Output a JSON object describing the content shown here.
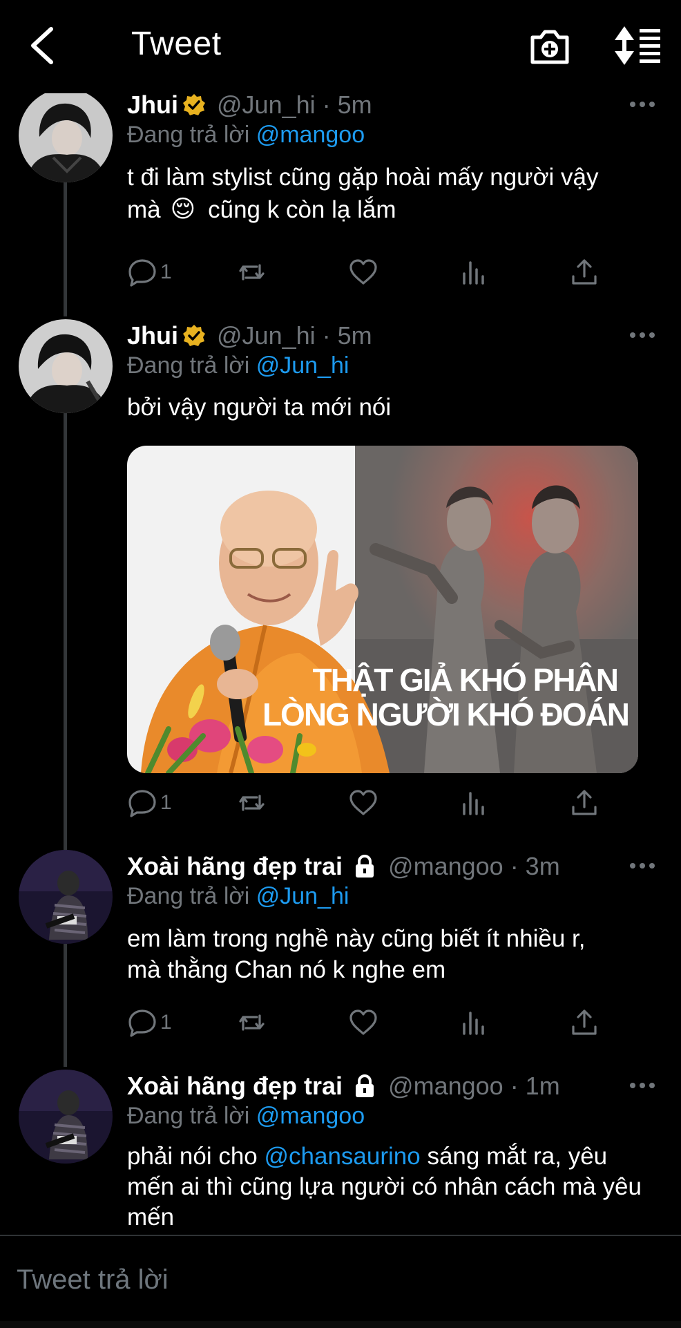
{
  "header": {
    "title": "Tweet",
    "back_icon": "chevron-left-icon",
    "camera_icon": "camera-add-icon",
    "sort_icon": "sort-icon"
  },
  "tweets": [
    {
      "name": "Jhui",
      "verified": true,
      "handle_time": "@Jun_hi · 5m",
      "reply_prefix": "Đang trả lời",
      "reply_to": "@mangoo",
      "text_line1": "t đi làm stylist cũng gặp hoài mấy người vậy",
      "text_line2_a": "mà",
      "text_line2_emoji": "😌",
      "text_line2_b": "cũng k còn lạ lắm",
      "reply_count": "1"
    },
    {
      "name": "Jhui",
      "verified": true,
      "handle_time": "@Jun_hi · 5m",
      "reply_prefix": "Đang trả lời",
      "reply_to": "@Jun_hi",
      "text": "bởi vậy người ta mới nói",
      "media_caption_line1": "THẬT GIẢ KHÓ PHÂN",
      "media_caption_line2": "LÒNG NGƯỜI KHÓ ĐOÁN",
      "reply_count": "1"
    },
    {
      "name": "Xoài hãng đẹp trai",
      "protected": true,
      "handle_time": "@mangoo · 3m",
      "reply_prefix": "Đang trả lời",
      "reply_to": "@Jun_hi",
      "text_line1": "em làm trong nghề này cũng biết ít nhiều r,",
      "text_line2": "mà thằng Chan nó k nghe em",
      "reply_count": "1"
    },
    {
      "name": "Xoài hãng đẹp trai",
      "protected": true,
      "handle_time": "@mangoo · 1m",
      "reply_prefix": "Đang trả lời",
      "reply_to": "@mangoo",
      "text_a": "phải nói cho",
      "text_mention": "@chansaurino",
      "text_b": "sáng mắt ra, yêu mến ai thì cũng lựa người có nhân cách mà yêu mến"
    }
  ],
  "composer": {
    "placeholder": "Tweet trả lời"
  },
  "colors": {
    "background": "#000000",
    "accent": "#1d9bf0",
    "secondary_text": "#71767b",
    "verified_gold": "#e8b220"
  }
}
